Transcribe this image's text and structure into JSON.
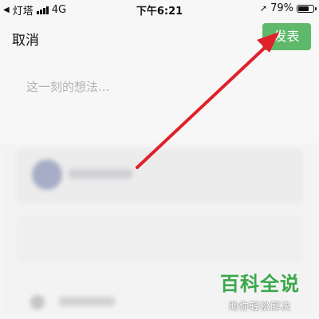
{
  "status_bar": {
    "carrier": "灯塔",
    "network": "4G",
    "time": "下午6:21",
    "battery_percent": "79%",
    "battery_level": 0.79
  },
  "top_bar": {
    "cancel_label": "取消",
    "publish_label": "发表",
    "publish_color": "#5fb96b"
  },
  "composer": {
    "placeholder": "这一刻的想法..."
  },
  "watermark": {
    "title": "百科全说",
    "subtitle": "助你轻松解决"
  },
  "annotation": {
    "arrow_color": "#e0202a"
  }
}
